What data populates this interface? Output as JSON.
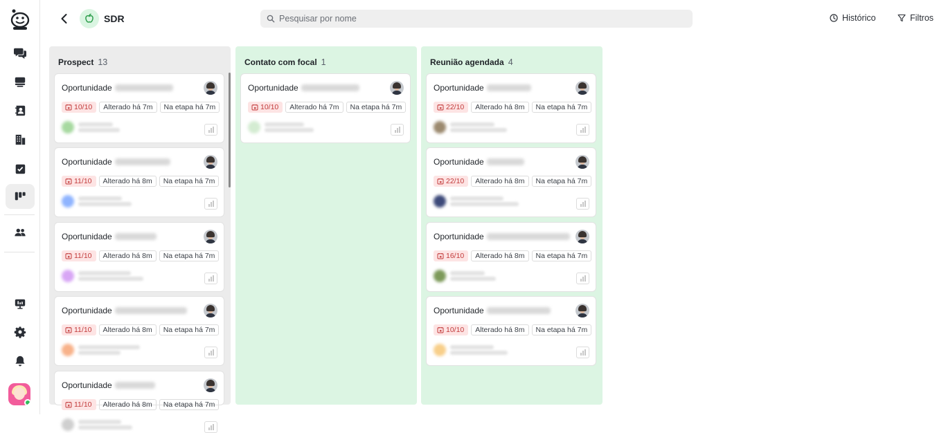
{
  "header": {
    "pipeline_name": "SDR",
    "search_placeholder": "Pesquisar por nome",
    "history_label": "Histórico",
    "filters_label": "Filtros"
  },
  "colors": {
    "prospect_bg": "#ececec",
    "green_bg": "#dcf5e3",
    "due_bg": "#fde4e4",
    "due_text": "#c23a3a"
  },
  "columns": [
    {
      "name": "Prospect",
      "count": "13",
      "cards": [
        {
          "title": "Oportunidade",
          "due": "10/10",
          "changed": "Alterado há 7m",
          "stage": "Na etapa há 7m",
          "contact_color": "#a7d9a0"
        },
        {
          "title": "Oportunidade",
          "due": "11/10",
          "changed": "Alterado há 8m",
          "stage": "Na etapa há 7m",
          "contact_color": "#8fb4ff"
        },
        {
          "title": "Oportunidade",
          "due": "11/10",
          "changed": "Alterado há 8m",
          "stage": "Na etapa há 7m",
          "contact_color": "#d8a6f5"
        },
        {
          "title": "Oportunidade",
          "due": "11/10",
          "changed": "Alterado há 8m",
          "stage": "Na etapa há 7m",
          "contact_color": "#f8b28a"
        },
        {
          "title": "Oportunidade",
          "due": "11/10",
          "changed": "Alterado há 8m",
          "stage": "Na etapa há 7m",
          "contact_color": "#cfcfcf"
        }
      ]
    },
    {
      "name": "Contato com focal",
      "count": "1",
      "cards": [
        {
          "title": "Oportunidade",
          "due": "10/10",
          "changed": "Alterado há 7m",
          "stage": "Na etapa há 7m",
          "contact_color": "#d4ecd2"
        }
      ]
    },
    {
      "name": "Reunião agendada",
      "count": "4",
      "cards": [
        {
          "title": "Oportunidade",
          "due": "22/10",
          "changed": "Alterado há 8m",
          "stage": "Na etapa há 7m",
          "contact_color": "#9c8a6f"
        },
        {
          "title": "Oportunidade",
          "due": "22/10",
          "changed": "Alterado há 8m",
          "stage": "Na etapa há 7m",
          "contact_color": "#3d4a7a"
        },
        {
          "title": "Oportunidade",
          "due": "16/10",
          "changed": "Alterado há 8m",
          "stage": "Na etapa há 7m",
          "contact_color": "#7d9a5a"
        },
        {
          "title": "Oportunidade",
          "due": "10/10",
          "changed": "Alterado há 8m",
          "stage": "Na etapa há 7m",
          "contact_color": "#f8cf8a"
        }
      ]
    }
  ]
}
